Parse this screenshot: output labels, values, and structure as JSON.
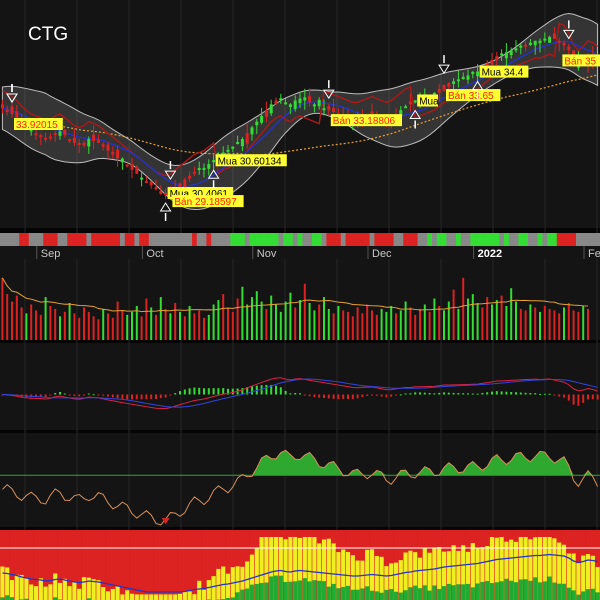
{
  "ticker": "CTG",
  "colors": {
    "background": "#141414",
    "grid": "#262626",
    "up": "#33dd33",
    "down": "#dd2222",
    "band": "#bdbdbd",
    "ma_blue": "#2233cc",
    "ma_orange": "#e8a030",
    "label_bg": "#ffff33",
    "sell_text": "#ff2200",
    "buy_text": "#000000"
  },
  "chart_data": [
    {
      "type": "line",
      "panel": "price",
      "months": [
        {
          "label": "Sep",
          "x": 8
        },
        {
          "label": "Oct",
          "x": 30
        },
        {
          "label": "Nov",
          "x": 53
        },
        {
          "label": "Dec",
          "x": 77
        },
        {
          "label": "2022",
          "x": 99,
          "bold": true
        },
        {
          "label": "Feb",
          "x": 122
        }
      ],
      "close": [
        33.8,
        33.7,
        33.5,
        33.3,
        33.0,
        32.8,
        32.6,
        32.5,
        32.4,
        32.2,
        32.3,
        32.5,
        32.6,
        32.4,
        32.2,
        32.0,
        31.9,
        32.0,
        32.2,
        32.1,
        32.0,
        31.8,
        31.6,
        31.4,
        31.2,
        31.0,
        30.8,
        30.6,
        30.4,
        30.2,
        30.0,
        29.8,
        29.6,
        29.5,
        29.4,
        29.5,
        29.7,
        29.9,
        30.1,
        30.3,
        30.5,
        30.6,
        30.7,
        30.9,
        31.1,
        31.3,
        31.5,
        31.6,
        31.8,
        32.0,
        32.2,
        32.5,
        32.8,
        33.1,
        33.4,
        33.7,
        34.0,
        34.2,
        34.3,
        34.1,
        34.0,
        34.2,
        34.3,
        34.2,
        34.1,
        34.0,
        33.9,
        33.8,
        33.7,
        33.6,
        33.5,
        33.4,
        33.3,
        33.2,
        33.2,
        33.3,
        33.4,
        33.5,
        33.4,
        33.3,
        33.2,
        33.3,
        33.5,
        33.7,
        33.9,
        34.0,
        34.2,
        34.3,
        34.4,
        34.5,
        34.6,
        34.8,
        35.0,
        35.1,
        35.2,
        35.3,
        35.4,
        35.5,
        35.6,
        35.7,
        35.9,
        36.1,
        36.3,
        36.5,
        36.6,
        36.7,
        36.8,
        36.9,
        37.0,
        37.1,
        37.2,
        37.3,
        37.3,
        37.4,
        37.5,
        37.4,
        37.3,
        37.2,
        36.8,
        36.2,
        35.9,
        36.1,
        36.4,
        36.3,
        36.1
      ],
      "ylim": [
        28.0,
        39.0
      ],
      "signals": [
        {
          "i": 2,
          "kind": "sell",
          "label": ""
        },
        {
          "i": 2,
          "kind": "sell",
          "label": "33.92015"
        },
        {
          "i": 34,
          "kind": "buy",
          "label": "Mua 30.4061"
        },
        {
          "i": 35,
          "kind": "sell",
          "label": "Bán 29.18597"
        },
        {
          "i": 44,
          "kind": "buy",
          "label": "Mua 30.60134"
        },
        {
          "i": 68,
          "kind": "sell",
          "label": "Bán 33.18806"
        },
        {
          "i": 86,
          "kind": "buy",
          "label": "Mua"
        },
        {
          "i": 92,
          "kind": "sell",
          "label": "Bán 33.65"
        },
        {
          "i": 99,
          "kind": "buy",
          "label": "Mua 34.4"
        },
        {
          "i": 118,
          "kind": "sell",
          "label": "Bán 35"
        }
      ]
    },
    {
      "type": "bar",
      "panel": "volume",
      "values": [
        4.2,
        3.1,
        2.6,
        3.0,
        2.2,
        1.8,
        2.4,
        2.0,
        1.7,
        2.9,
        2.3,
        2.1,
        1.6,
        1.9,
        2.5,
        1.8,
        1.5,
        2.2,
        1.9,
        1.6,
        1.4,
        2.1,
        1.8,
        1.5,
        2.6,
        2.0,
        1.7,
        1.9,
        2.3,
        1.6,
        2.8,
        2.2,
        1.7,
        2.9,
        2.1,
        1.8,
        2.5,
        1.9,
        1.6,
        2.3,
        1.8,
        2.0,
        1.5,
        1.7,
        2.4,
        2.7,
        3.1,
        2.2,
        1.9,
        2.8,
        3.6,
        2.4,
        2.9,
        3.3,
        2.6,
        2.1,
        3.0,
        2.4,
        1.9,
        2.6,
        3.2,
        2.2,
        2.7,
        3.8,
        2.5,
        2.0,
        2.4,
        2.9,
        2.1,
        1.8,
        2.3,
        2.0,
        1.9,
        1.6,
        2.2,
        1.8,
        2.4,
        2.0,
        1.7,
        2.1,
        1.9,
        2.3,
        1.8,
        2.0,
        2.6,
        2.2,
        1.7,
        2.1,
        2.4,
        1.9,
        2.8,
        2.3,
        2.0,
        2.6,
        3.4,
        2.1,
        4.2,
        2.8,
        3.1,
        2.5,
        2.2,
        2.9,
        2.4,
        2.7,
        3.0,
        2.3,
        3.5,
        2.6,
        2.1,
        2.0,
        2.4,
        2.2,
        1.9,
        2.3,
        2.1,
        2.0,
        1.8,
        2.2,
        2.5,
        2.0,
        1.9,
        2.3,
        2.1
      ],
      "ylim": [
        0,
        5
      ]
    },
    {
      "type": "line",
      "panel": "macd",
      "ylim": [
        -1.5,
        1.5
      ]
    },
    {
      "type": "area",
      "panel": "oscillator",
      "level": 55,
      "ylim": [
        0,
        100
      ]
    },
    {
      "type": "bar",
      "panel": "strength",
      "ylim": [
        0,
        100
      ]
    }
  ]
}
